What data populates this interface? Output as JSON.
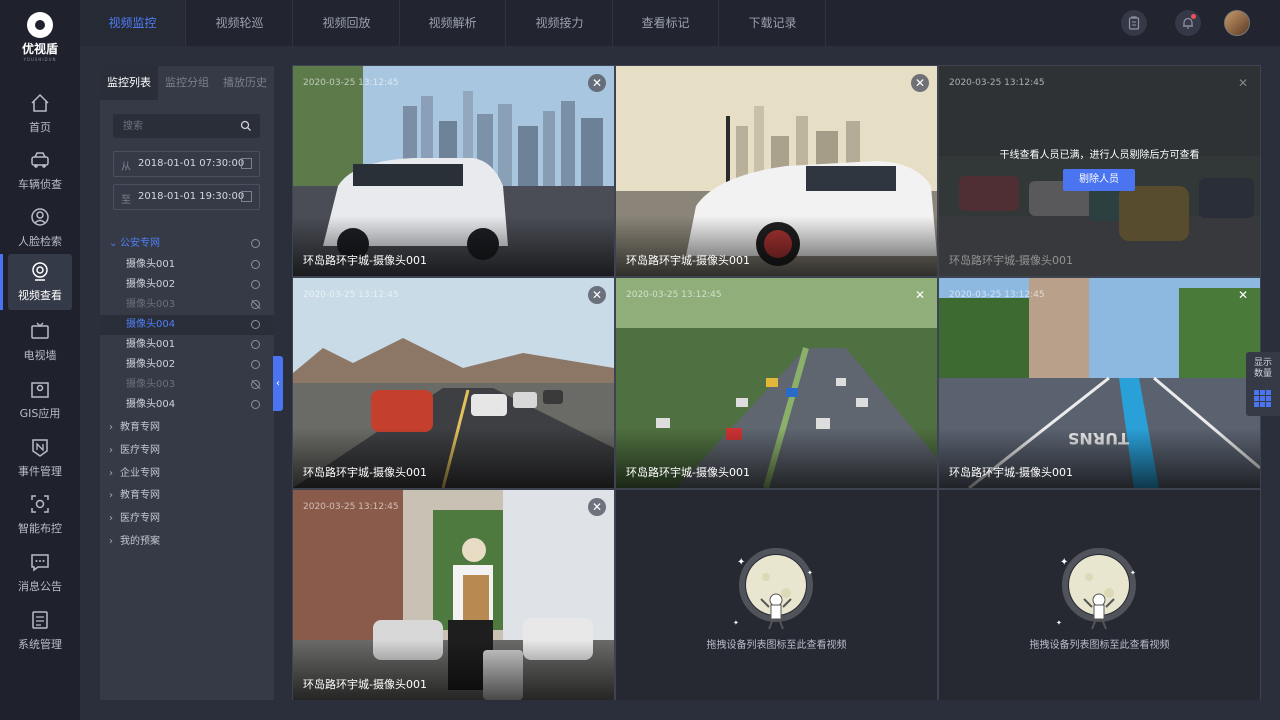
{
  "app": {
    "name": "优视盾",
    "name_sub": "YOUSHIDUN"
  },
  "nav": [
    {
      "label": "首页",
      "icon": "home-icon"
    },
    {
      "label": "车辆侦查",
      "icon": "car-icon"
    },
    {
      "label": "人脸检索",
      "icon": "face-icon"
    },
    {
      "label": "视频查看",
      "icon": "camera-icon",
      "active": true
    },
    {
      "label": "电视墙",
      "icon": "tv-icon"
    },
    {
      "label": "GIS应用",
      "icon": "map-icon"
    },
    {
      "label": "事件管理",
      "icon": "event-icon"
    },
    {
      "label": "智能布控",
      "icon": "surveillance-icon"
    },
    {
      "label": "消息公告",
      "icon": "message-icon"
    },
    {
      "label": "系统管理",
      "icon": "settings-icon"
    }
  ],
  "tabs": [
    {
      "label": "视频监控",
      "active": true
    },
    {
      "label": "视频轮巡"
    },
    {
      "label": "视频回放"
    },
    {
      "label": "视频解析"
    },
    {
      "label": "视频接力"
    },
    {
      "label": "查看标记"
    },
    {
      "label": "下载记录"
    }
  ],
  "panel": {
    "tabs": [
      "监控列表",
      "监控分组",
      "播放历史"
    ],
    "search_placeholder": "搜索",
    "from_label": "从",
    "from_value": "2018-01-01 07:30:00",
    "to_label": "至",
    "to_value": "2018-01-01 19:30:00",
    "tree": {
      "open_group": "公安专网",
      "cameras": [
        {
          "label": "摄像头001",
          "status": "online"
        },
        {
          "label": "摄像头002",
          "status": "online"
        },
        {
          "label": "摄像头003",
          "status": "offline"
        },
        {
          "label": "摄像头004",
          "status": "online",
          "selected": true
        },
        {
          "label": "摄像头001",
          "status": "online"
        },
        {
          "label": "摄像头002",
          "status": "online"
        },
        {
          "label": "摄像头003",
          "status": "offline"
        },
        {
          "label": "摄像头004",
          "status": "online"
        }
      ],
      "groups": [
        "教育专网",
        "医疗专网",
        "企业专网",
        "教育专网",
        "医疗专网",
        "我的预案"
      ]
    }
  },
  "grid": {
    "timestamp": "2020-03-25 13:12:45",
    "camera_name": "环岛路环宇城-摄像头001",
    "full_message": "干线查看人员已满，进行人员剔除后方可查看",
    "kick_button": "剔除人员",
    "empty_tip": "拖拽设备列表图标至此查看视频"
  },
  "float": {
    "label_line1": "显示",
    "label_line2": "数量"
  },
  "colors": {
    "accent": "#4a74f0",
    "background": "#2b2f3b",
    "sidebar": "#1f222c"
  }
}
